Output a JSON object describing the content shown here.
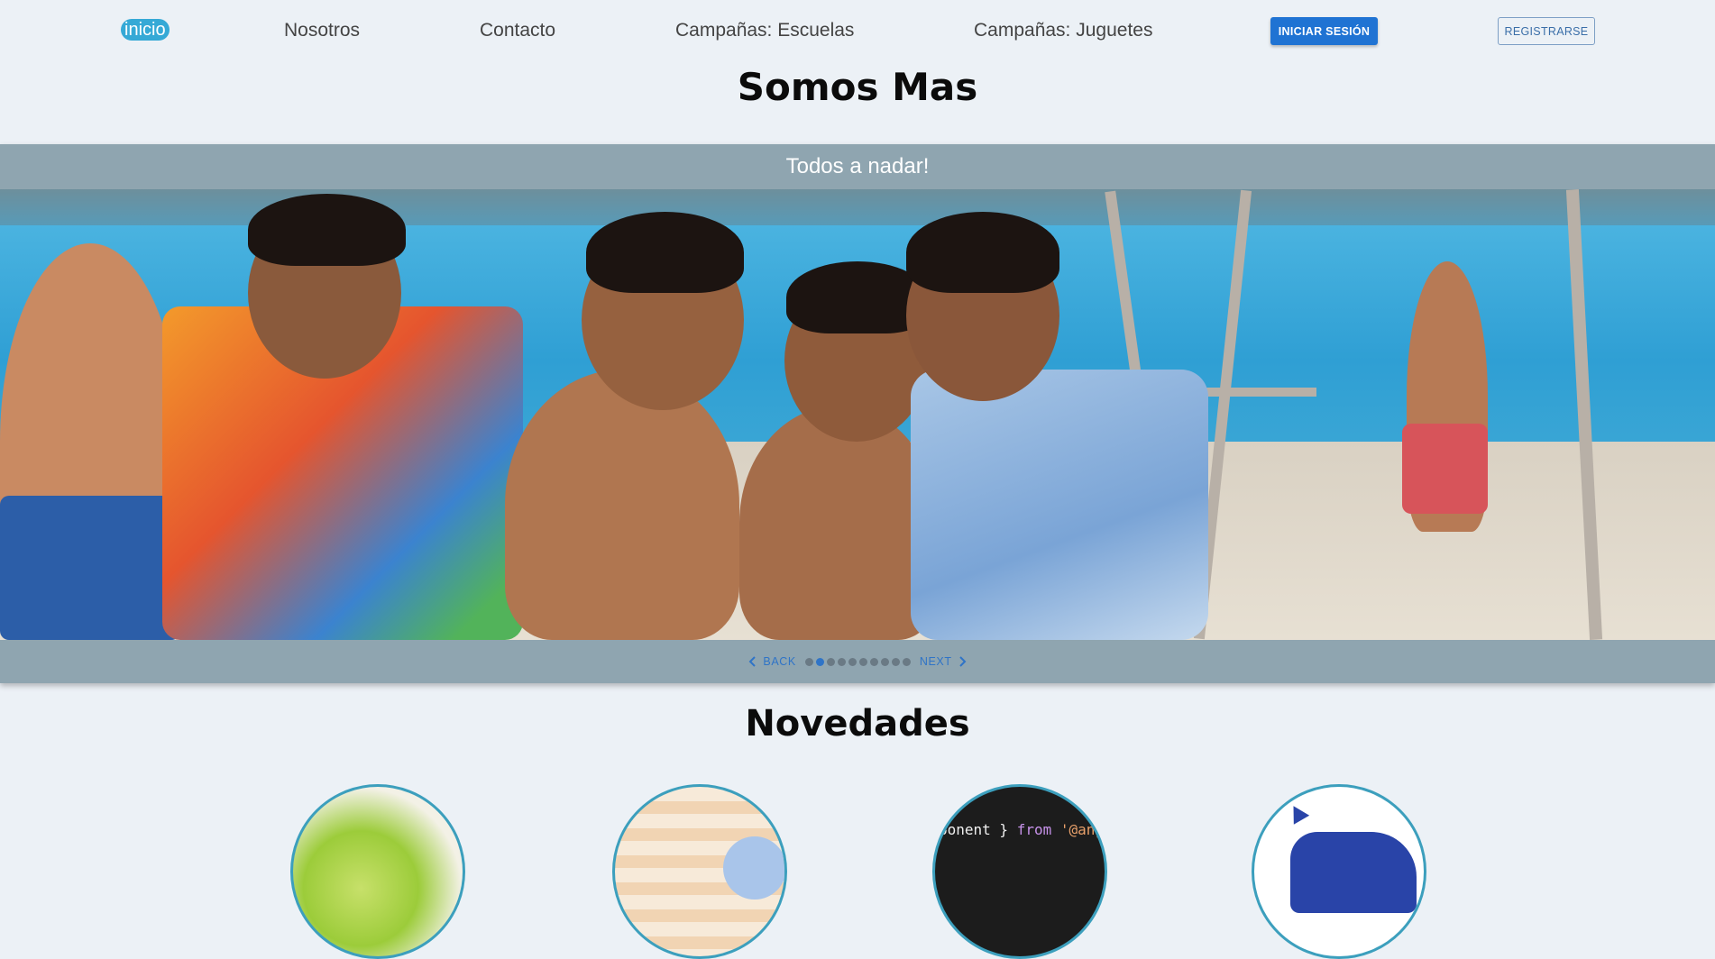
{
  "nav": {
    "home": "inicio",
    "links": [
      "Nosotros",
      "Contacto",
      "Campañas: Escuelas",
      "Campañas: Juguetes"
    ],
    "login": "INICIAR SESIÓN",
    "register": "REGISTRARSE"
  },
  "page_title": "Somos Mas",
  "carousel": {
    "slide_title": "Todos a nadar!",
    "back_label": "BACK",
    "next_label": "NEXT",
    "dot_count": 10,
    "active_dot": 1,
    "colors": {
      "bar": "#8fa5b0",
      "accent": "#2f74c7"
    }
  },
  "news": {
    "title": "Novedades",
    "code_snippet": [
      "ponent } ",
      "from",
      " '@ang"
    ]
  },
  "colors": {
    "home_badge": "#35a9d6",
    "login_button": "#1f73d3",
    "circle_border": "#3c9fbd"
  }
}
